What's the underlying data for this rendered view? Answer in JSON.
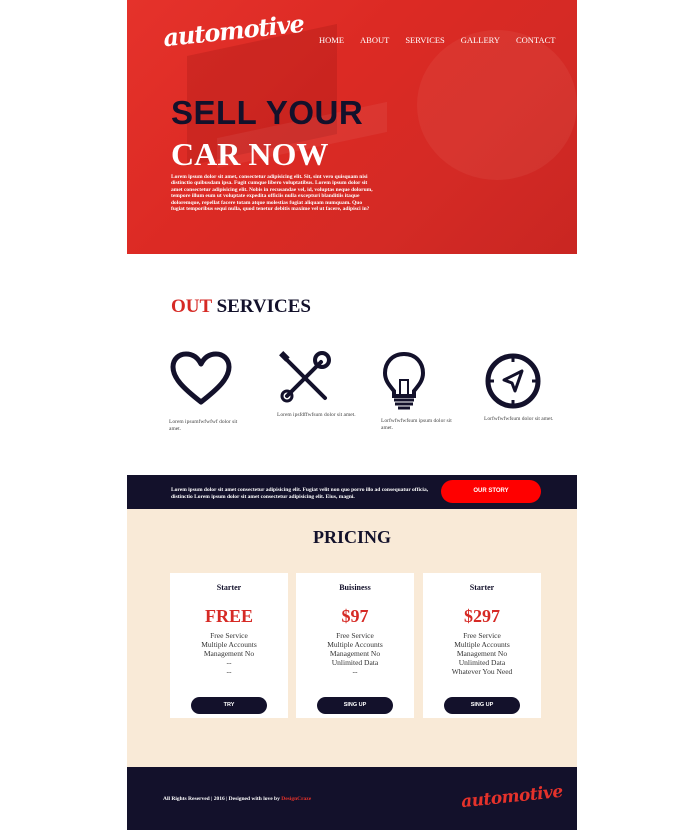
{
  "logo": "automotive",
  "nav": [
    "HOME",
    "ABOUT",
    "SERVICES",
    "GALLERY",
    "CONTACT"
  ],
  "hero": {
    "title_line1": "SELL YOUR",
    "title_line2": "CAR NOW",
    "text": "Lorem ipsum dolor sit amet, consectetur adipisicing elit. Sit, sint vero quisquam nisi distinctio quibusdam ipsa. Fugit cumque libero voluptatibus. Lorem ipsum dolor sit amet consectetur adipisicing elit. Nobis in recusandae vel, id, voluptas neque dolorum, tempore illum eum ut voluptate expedita officiis nulla excepturi blanditiis itaque doloremque, repellat facere totam atque molestias fugiat aliquam numquam. Quo fugiat temporibus sequi nulla, quod tenetur debitis maxime vel ut facere, adipisci in?"
  },
  "services": {
    "title_accent": "OUT",
    "title_rest": " SERVICES",
    "items": [
      {
        "icon": "heart-icon",
        "caption": "Lorem ipsumfwfwfwf dolor sit amet."
      },
      {
        "icon": "tools-icon",
        "caption": "Lorem ipsfdffwfsum dolor sit amet."
      },
      {
        "icon": "lightbulb-icon",
        "caption": "Lorfwfwfwfsum ipsum dolor sit amet."
      },
      {
        "icon": "compass-icon",
        "caption": "Lorfwfwfwfsum dolor sit amet."
      }
    ]
  },
  "banner": {
    "text": "Lorem ipsum dolor sit amet consectetur adipisicing elit. Fugiat velit non quo porro illo ad consequatur officia, distinctio Lorem ipsum dolor sit amet consectetur adipisicing elit. Eius, magni.",
    "button": "OUR STORY"
  },
  "pricing": {
    "title": "PRICING",
    "plans": [
      {
        "name": "Starter",
        "price": "FREE",
        "features": [
          "Free Service",
          "Multiple Accounts",
          "Management No",
          "--",
          "--"
        ],
        "button": "TRY"
      },
      {
        "name": "Buisiness",
        "price": "$97",
        "features": [
          "Free Service",
          "Multiple Accounts",
          "Management No",
          "Unlimited Data",
          "--"
        ],
        "button": "SING UP"
      },
      {
        "name": "Starter",
        "price": "$297",
        "features": [
          "Free Service",
          "Multiple Accounts",
          "Management No",
          "Unlimited Data",
          "Whatever You Need"
        ],
        "button": "SING UP"
      }
    ]
  },
  "footer": {
    "text": "All Rights Reserved | 2016 | Designed with love by ",
    "brand": "DesignCraze",
    "logo": "automotive"
  },
  "colors": {
    "accent": "#e5322b",
    "dark": "#13112b",
    "cream": "#f9ead7",
    "button_red": "#ff0000"
  }
}
